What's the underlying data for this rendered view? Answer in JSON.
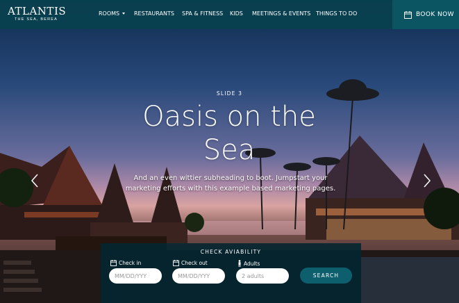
{
  "brand": {
    "name": "ATLANTIS",
    "tagline": "THE SEA, BEREA"
  },
  "nav": {
    "items": [
      {
        "label": "ROOMS",
        "has_dropdown": true
      },
      {
        "label": "RESTAURANTS"
      },
      {
        "label": "SPA & FITNESS"
      },
      {
        "label": "KIDS"
      },
      {
        "label": "MEETINGS & EVENTS"
      },
      {
        "label": "THINGS TO DO"
      }
    ],
    "book_label": "BOOK NOW"
  },
  "hero": {
    "kicker": "SLIDE 3",
    "title": "Oasis on the Sea",
    "subtitle": "And an even wittier subheading to boot. Jumpstart your marketing efforts with this example based marketing pages."
  },
  "booking": {
    "title": "CHECK AVIABILITY",
    "check_in": {
      "label": "Check in",
      "placeholder": "MM/DD/YYY"
    },
    "check_out": {
      "label": "Check out",
      "placeholder": "MM/DD/YYY"
    },
    "adults": {
      "label": "Adults",
      "placeholder": "2 adults"
    },
    "search_label": "SEARCH"
  },
  "colors": {
    "nav_bg": "#08424e",
    "book_bg": "#0b5563",
    "panel_bg": "#032630",
    "search_btn": "#0e5f6e"
  },
  "icons": [
    "calendar-icon",
    "chevron-left-icon",
    "chevron-right-icon",
    "person-icon"
  ]
}
